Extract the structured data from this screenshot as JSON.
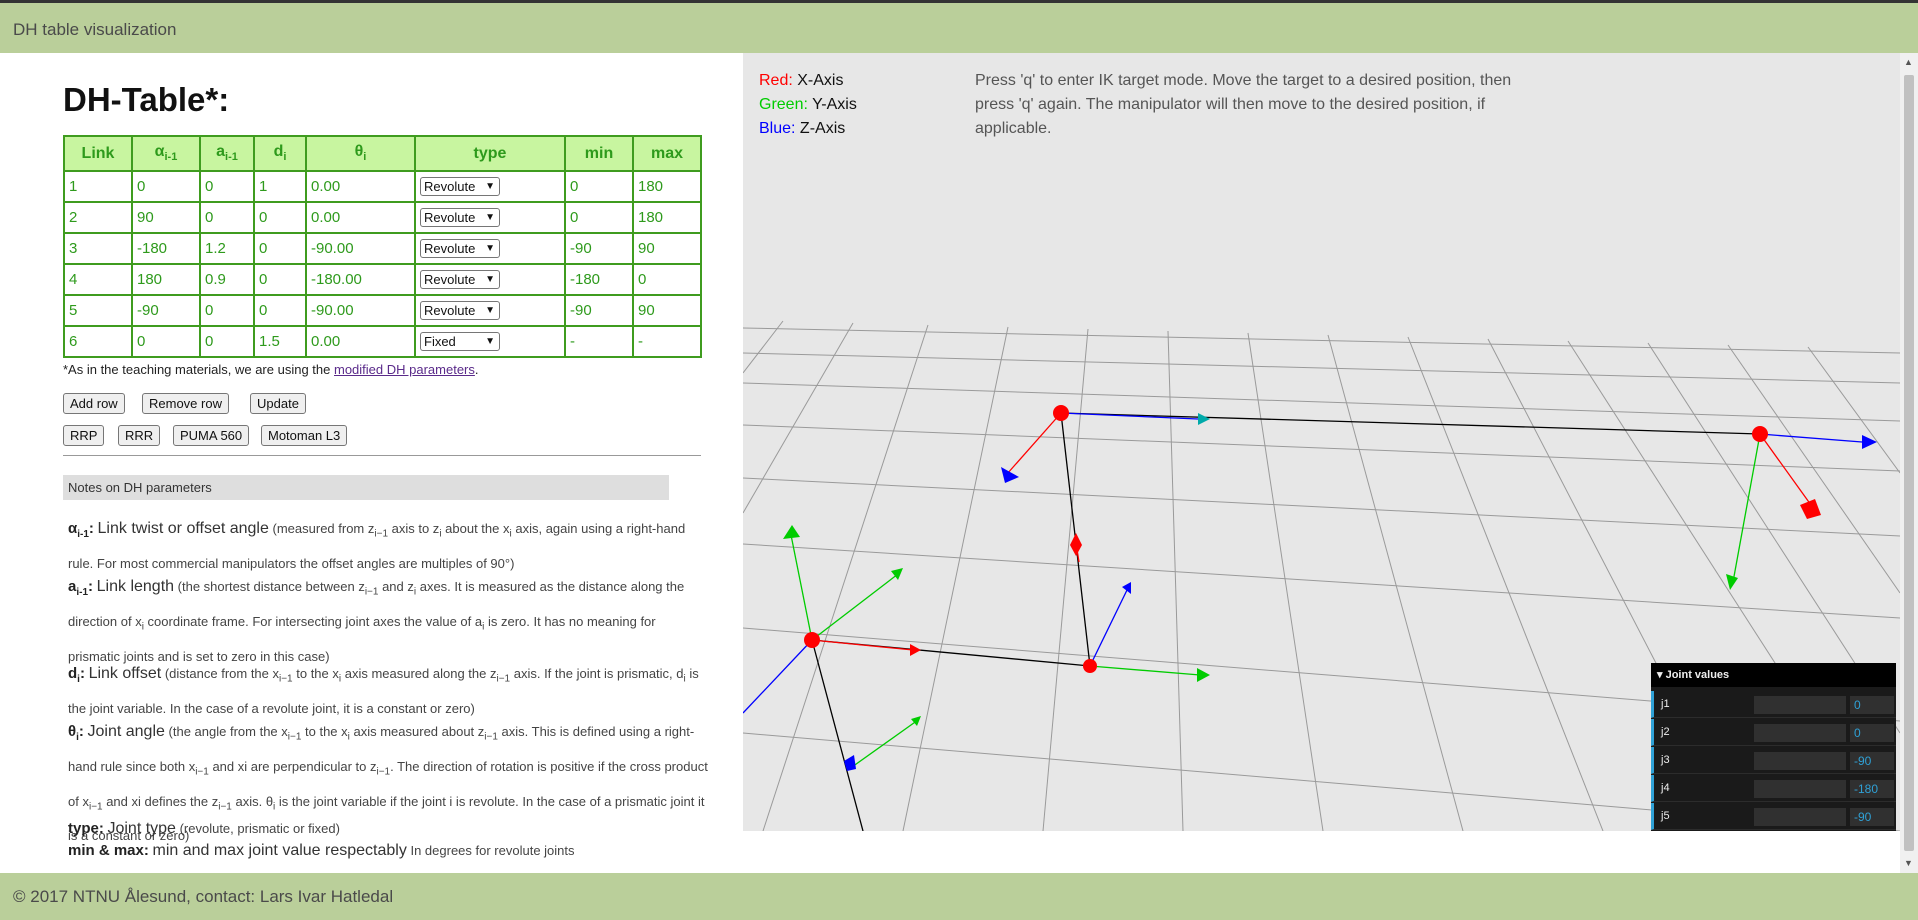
{
  "header": {
    "title": "DH table visualization"
  },
  "footer": {
    "text": "© 2017 NTNU Ålesund, contact: Lars Ivar Hatledal"
  },
  "panel": {
    "title": "DH-Table*:",
    "columns": [
      "Link",
      "α",
      "i-1",
      "a",
      "i-1",
      "d",
      "i",
      "θ",
      "i",
      "type",
      "min",
      "max"
    ],
    "rows": [
      {
        "link": "1",
        "alpha": "0",
        "a": "0",
        "d": "1",
        "theta": "0.00",
        "type": "Revolute",
        "min": "0",
        "max": "180"
      },
      {
        "link": "2",
        "alpha": "90",
        "a": "0",
        "d": "0",
        "theta": "0.00",
        "type": "Revolute",
        "min": "0",
        "max": "180"
      },
      {
        "link": "3",
        "alpha": "-180",
        "a": "1.2",
        "d": "0",
        "theta": "-90.00",
        "type": "Revolute",
        "min": "-90",
        "max": "90"
      },
      {
        "link": "4",
        "alpha": "180",
        "a": "0.9",
        "d": "0",
        "theta": "-180.00",
        "type": "Revolute",
        "min": "-180",
        "max": "0"
      },
      {
        "link": "5",
        "alpha": "-90",
        "a": "0",
        "d": "0",
        "theta": "-90.00",
        "type": "Revolute",
        "min": "-90",
        "max": "90"
      },
      {
        "link": "6",
        "alpha": "0",
        "a": "0",
        "d": "1.5",
        "theta": "0.00",
        "type": "Fixed",
        "min": "-",
        "max": "-"
      }
    ],
    "footnote_prefix": "*As in the teaching materials, we are using the",
    "footnote_link": "modified DH parameters",
    "footnote_suffix": ".",
    "buttons": {
      "add_row": "Add row",
      "remove_row": "Remove row",
      "update": "Update"
    },
    "presets": [
      "RRP",
      "RRR",
      "PUMA 560",
      "Motoman L3"
    ],
    "notes_heading": "Notes on DH parameters",
    "notes": {
      "alpha_sym": "α",
      "alpha_sub": "i-1",
      "alpha_name": "Link twist or offset angle",
      "alpha_desc_1": "(measured from z",
      "alpha_sub_1": "i−1",
      "alpha_desc_2": " axis to z",
      "alpha_sub_2": "i",
      "alpha_desc_3": " about the x",
      "alpha_sub_3": "i",
      "alpha_desc_4": " axis, again using a right-hand rule. For most commercial manipulators the offset angles are multiples of 90°)",
      "a_sym": "a",
      "a_sub": "i-1",
      "a_name": "Link length",
      "a_desc_1": "(the shortest distance between z",
      "a_sub_1": "i−1",
      "a_desc_2": " and z",
      "a_sub_2": "i",
      "a_desc_3": " axes. It is measured as the distance along the direction of x",
      "a_sub_3": "i",
      "a_desc_4": " coordinate frame. For intersecting joint axes the value of a",
      "a_sub_4": "i",
      "a_desc_5": " is zero. It has no meaning for prismatic joints and is set to zero in this case)",
      "d_sym": "d",
      "d_sub": "i",
      "d_name": "Link offset",
      "d_desc_1": "(distance from the x",
      "d_sub_1": "i−1",
      "d_desc_2": " to the x",
      "d_sub_2": "i",
      "d_desc_3": " axis measured along the z",
      "d_sub_3": "i−1",
      "d_desc_4": " axis. If the joint is prismatic, d",
      "d_sub_4": "i",
      "d_desc_5": " is the joint variable. In the case of a revolute joint, it is a constant or zero)",
      "t_sym": "θ",
      "t_sub": "i",
      "t_name": "Joint angle",
      "t_desc_1": "(the angle from the x",
      "t_sub_1": "i−1",
      "t_desc_2": " to the x",
      "t_sub_2": "i",
      "t_desc_3": " axis measured about z",
      "t_sub_3": "i−1",
      "t_desc_4": " axis. This is defined using a right-hand rule since both x",
      "t_sub_4": "i−1",
      "t_desc_5": " and xi are perpendicular to z",
      "t_sub_5": "i−1",
      "t_desc_6": ". The direction of rotation is positive if the cross product of x",
      "t_sub_6": "i−1",
      "t_desc_7": " and xi defines the z",
      "t_sub_7": "i−1",
      "t_desc_8": " axis. θ",
      "t_sub_8": "i",
      "t_desc_9": " is the joint variable if the joint i is revolute. In the case of a prismatic joint it is a constant or zero)",
      "type_name": "type:",
      "type_main": "Joint type",
      "type_desc": "(revolute, prismatic or fixed)",
      "mm_name": "min & max:",
      "mm_main": "min and max joint value respectably",
      "mm_desc": "In degrees for revolute joints"
    }
  },
  "viewport": {
    "legend": [
      {
        "color_word": "Red:",
        "axis": "X-Axis",
        "color": "#ff0000"
      },
      {
        "color_word": "Green:",
        "axis": "Y-Axis",
        "color": "#00cc00"
      },
      {
        "color_word": "Blue:",
        "axis": "Z-Axis",
        "color": "#0000ff"
      }
    ],
    "info": "Press 'q' to enter IK target mode. Move the target to a desired position, then press 'q' again. The manipulator will then move to the desired position, if applicable."
  },
  "joint_gui": {
    "title": "Joint values",
    "joints": [
      {
        "name": "j1",
        "value": "0"
      },
      {
        "name": "j2",
        "value": "0"
      },
      {
        "name": "j3",
        "value": "-90"
      },
      {
        "name": "j4",
        "value": "-180"
      },
      {
        "name": "j5",
        "value": "-90"
      }
    ]
  },
  "colors": {
    "header_bg": "#bacf9a",
    "table_border": "#3f9c1f",
    "table_text": "#2e9a1c",
    "table_head_bg": "#c8f5a0",
    "gui_accent": "#2fa1d6"
  }
}
